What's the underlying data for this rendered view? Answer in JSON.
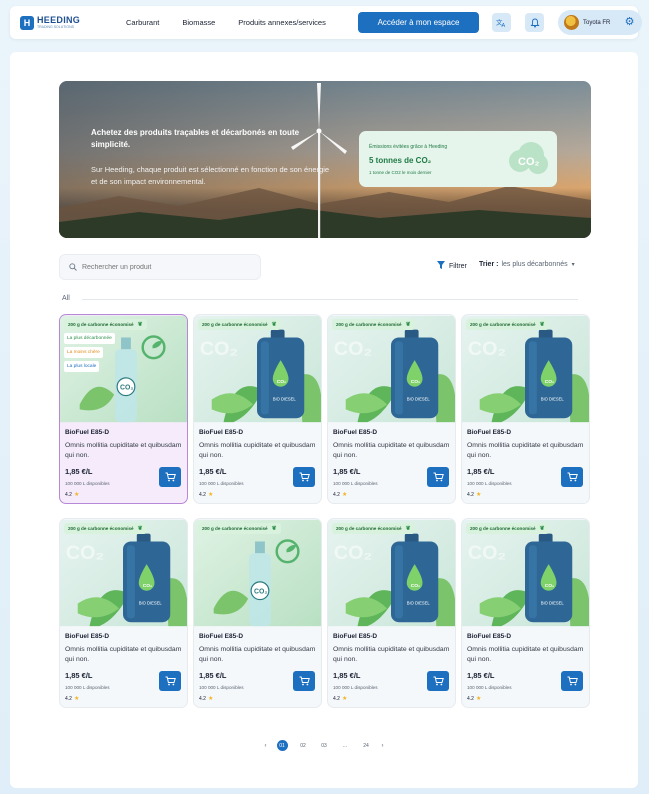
{
  "header": {
    "logo_text": "HEEDING",
    "logo_sub": "TRADING SOLUTIONS",
    "nav": [
      "Carburant",
      "Biomasse",
      "Produits annexes/services"
    ],
    "cta_label": "Accéder à mon espace",
    "user_name": "Toyota FR",
    "icons": [
      "translate-icon",
      "bell-icon",
      "gear-icon"
    ]
  },
  "hero": {
    "title": "Achetez des produits traçables et décarbonés en toute simplicité.",
    "description": "Sur Heeding, chaque produit est sélectionné en fonction de son énergie et de son impact environnemental.",
    "emission_label": "Émissions évitées grâce à Heeding",
    "emission_value": "5 tonnes de CO₂",
    "emission_sub": "1 tonne de CO2 le mois dernier",
    "badge_text": "CO₂"
  },
  "toolbar": {
    "search_placeholder": "Rechercher un produit",
    "filter_label": "Filtrer",
    "sort_label": "Trier :",
    "sort_value": "les plus décarbonnés"
  },
  "tabs": {
    "all": "All"
  },
  "products": [
    {
      "badge": "200 g de carbonne économisé",
      "name": "BioFuel E85-D",
      "desc": "Omnis mollitia cupiditate et quibusdam qui non.",
      "price": "1,85 €/L",
      "stock": "100 000 L disponibles",
      "rating": "4.2",
      "image": "bottle",
      "tags": [
        "La plus décarbonnée",
        "La moins chère",
        "La plus locale"
      ]
    },
    {
      "badge": "200 g de carbonne économisé",
      "name": "BioFuel E85-D",
      "desc": "Omnis mollitia cupiditate et quibusdam qui non.",
      "price": "1,85 €/L",
      "stock": "100 000 L disponibles",
      "rating": "4.2",
      "image": "canister",
      "tags": []
    },
    {
      "badge": "200 g de carbonne économisé",
      "name": "BioFuel E85-D",
      "desc": "Omnis mollitia cupiditate et quibusdam qui non.",
      "price": "1,85 €/L",
      "stock": "100 000 L disponibles",
      "rating": "4.2",
      "image": "canister",
      "tags": []
    },
    {
      "badge": "200 g de carbonne économisé",
      "name": "BioFuel E85-D",
      "desc": "Omnis mollitia cupiditate et quibusdam qui non.",
      "price": "1,85 €/L",
      "stock": "100 000 L disponibles",
      "rating": "4.2",
      "image": "canister",
      "tags": []
    },
    {
      "badge": "200 g de carbonne économisé",
      "name": "BioFuel E85-D",
      "desc": "Omnis mollitia cupiditate et quibusdam qui non.",
      "price": "1,85 €/L",
      "stock": "100 000 L disponibles",
      "rating": "4.2",
      "image": "canister",
      "tags": []
    },
    {
      "badge": "200 g de carbonne économisé",
      "name": "BioFuel E85-D",
      "desc": "Omnis mollitia cupiditate et quibusdam qui non.",
      "price": "1,85 €/L",
      "stock": "100 000 L disponibles",
      "rating": "4.2",
      "image": "bottle",
      "tags": []
    },
    {
      "badge": "200 g de carbonne économisé",
      "name": "BioFuel E85-D",
      "desc": "Omnis mollitia cupiditate et quibusdam qui non.",
      "price": "1,85 €/L",
      "stock": "100 000 L disponibles",
      "rating": "4.2",
      "image": "canister",
      "tags": []
    },
    {
      "badge": "200 g de carbonne économisé",
      "name": "BioFuel E85-D",
      "desc": "Omnis mollitia cupiditate et quibusdam qui non.",
      "price": "1,85 €/L",
      "stock": "100 000 L disponibles",
      "rating": "4.2",
      "image": "canister",
      "tags": []
    }
  ],
  "pagination": {
    "pages": [
      "01",
      "02",
      "03",
      "...",
      "24"
    ],
    "active": "01"
  },
  "colors": {
    "primary": "#1d6fbf",
    "green": "#2c8f49",
    "featured_border": "#b788d8"
  }
}
